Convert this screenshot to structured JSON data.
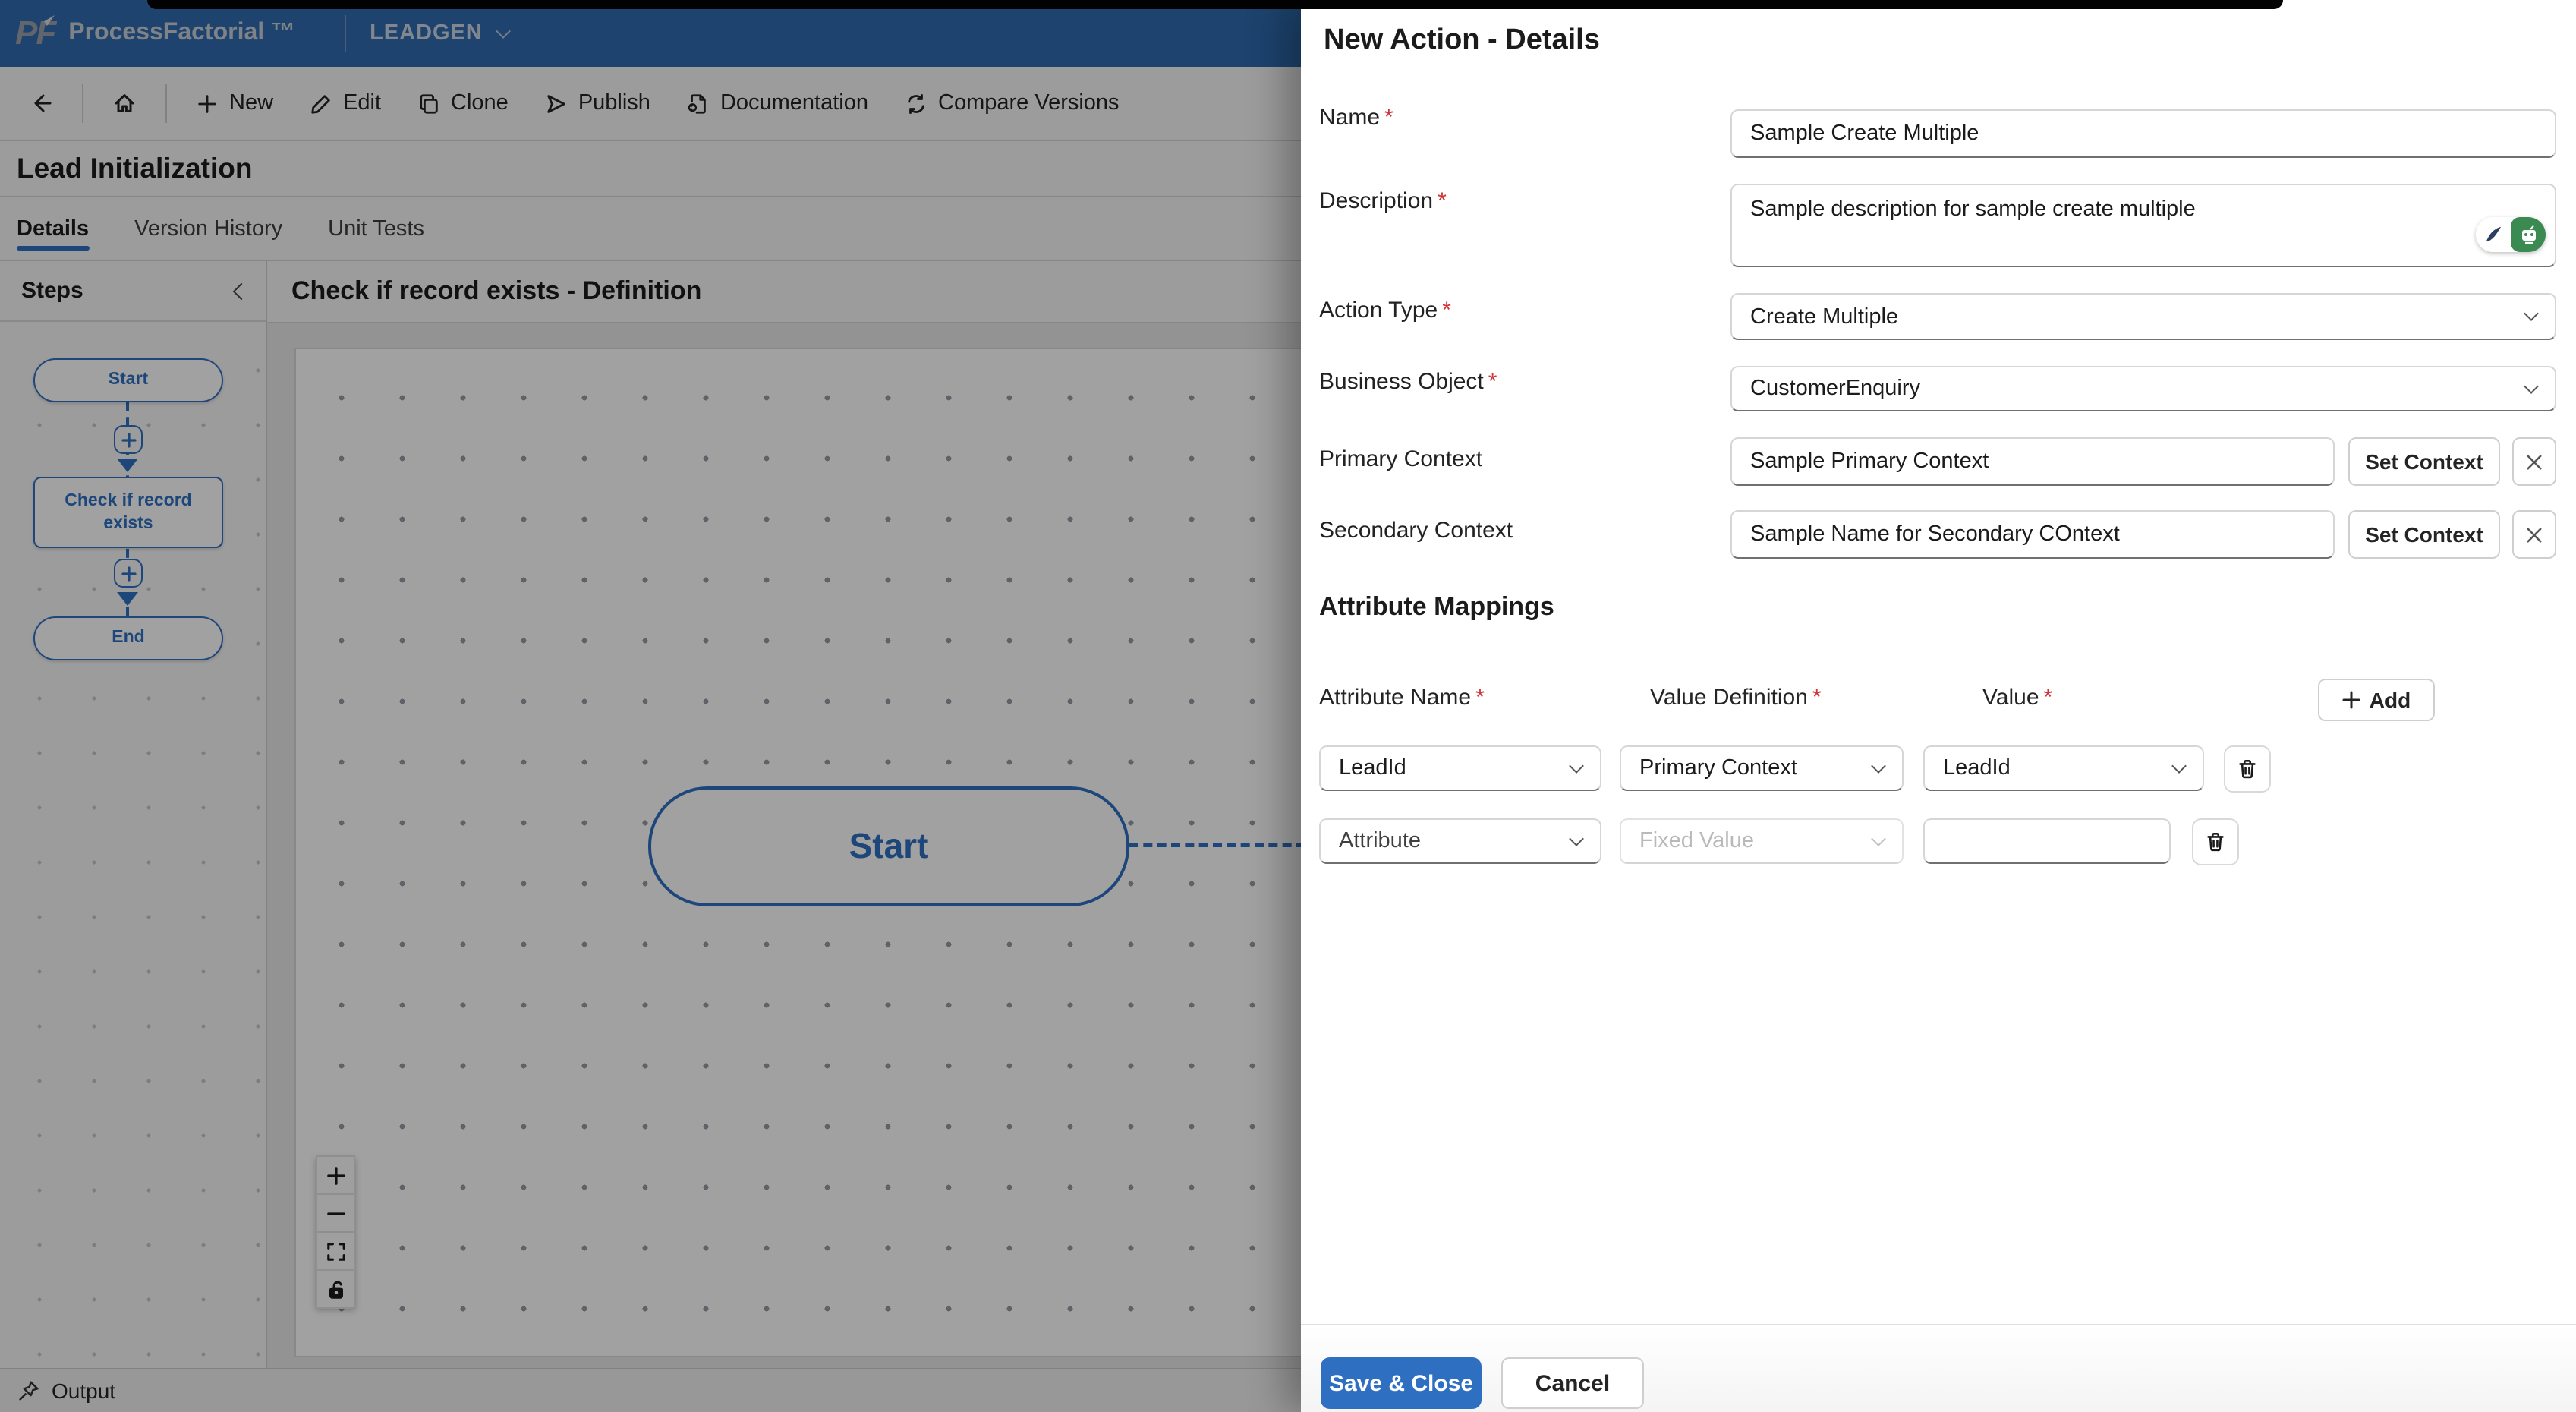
{
  "app": {
    "brand": "ProcessFactorial ™",
    "workspace": "LEADGEN"
  },
  "toolbar": {
    "items": [
      {
        "label": "New"
      },
      {
        "label": "Edit"
      },
      {
        "label": "Clone"
      },
      {
        "label": "Publish"
      },
      {
        "label": "Documentation"
      },
      {
        "label": "Compare Versions"
      }
    ]
  },
  "page": {
    "title": "Lead Initialization",
    "tabs": [
      {
        "label": "Details"
      },
      {
        "label": "Version History"
      },
      {
        "label": "Unit Tests"
      }
    ]
  },
  "steps_panel": {
    "title": "Steps",
    "nodes": [
      {
        "label": "Start"
      },
      {
        "label": "Check if record exists"
      },
      {
        "label": "End"
      }
    ]
  },
  "definition": {
    "title": "Check if record exists - Definition",
    "canvas_node": "Start"
  },
  "output_bar": {
    "label": "Output"
  },
  "misc": {
    "required_marker": "*"
  },
  "drawer": {
    "title": "New Action - Details",
    "fields": {
      "name": {
        "label": "Name",
        "value": "Sample Create Multiple"
      },
      "description": {
        "label": "Description",
        "value": "Sample description for sample create multiple"
      },
      "action_type": {
        "label": "Action Type",
        "value": "Create Multiple"
      },
      "business_object": {
        "label": "Business Object",
        "value": "CustomerEnquiry"
      },
      "primary_context": {
        "label": "Primary Context",
        "value": "Sample Primary Context",
        "button": "Set Context"
      },
      "secondary_context": {
        "label": "Secondary Context",
        "value": "Sample Name for Secondary COntext",
        "button": "Set Context"
      }
    },
    "attribute_mappings": {
      "title": "Attribute Mappings",
      "columns": [
        "Attribute Name",
        "Value Definition",
        "Value"
      ],
      "add_label": "Add",
      "rows": [
        {
          "attribute": "LeadId",
          "value_definition": "Primary Context",
          "value": "LeadId"
        },
        {
          "attribute": "Attribute",
          "value_definition": "Fixed Value",
          "value": ""
        }
      ]
    },
    "footer": {
      "save_label": "Save & Close",
      "cancel_label": "Cancel"
    }
  },
  "colors": {
    "primary_blue": "#2e6fc1",
    "header_navy": "#2f6bae",
    "accent_green": "#3a8a52",
    "accent_navy": "#2d3e63",
    "danger_red": "#d13438"
  }
}
